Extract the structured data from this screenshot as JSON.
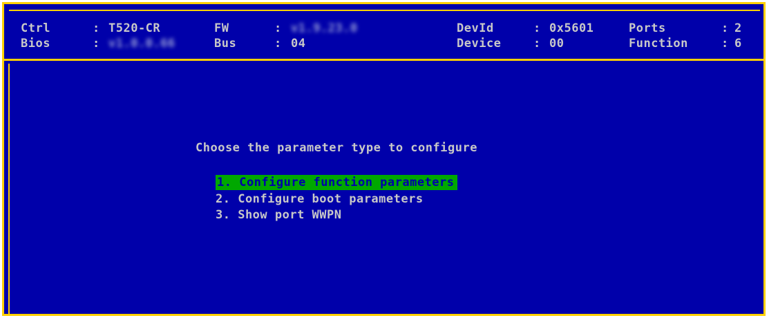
{
  "header": {
    "ctrl": {
      "label": "Ctrl",
      "sep": ":",
      "value": "T520-CR"
    },
    "bios": {
      "label": "Bios",
      "sep": ":",
      "value": "v1.0.0.66"
    },
    "fw": {
      "label": "FW",
      "sep": ":",
      "value": "v1.9.23.0"
    },
    "bus": {
      "label": "Bus",
      "sep": ":",
      "value": "04"
    },
    "devid": {
      "label": "DevId",
      "sep": ":",
      "value": "0x5601"
    },
    "device": {
      "label": "Device",
      "sep": ":",
      "value": "00"
    },
    "ports": {
      "label": "Ports",
      "sep": ":",
      "value": "2"
    },
    "function": {
      "label": "Function",
      "sep": ":",
      "value": "6"
    }
  },
  "menu": {
    "title": "Choose the parameter type to configure",
    "items": [
      {
        "label": "1. Configure function parameters",
        "selected": true
      },
      {
        "label": "2. Configure boot parameters",
        "selected": false
      },
      {
        "label": "3. Show port WWPN",
        "selected": false
      }
    ]
  },
  "colors": {
    "background": "#0000aa",
    "border": "#ffd000",
    "text": "#c8c8c8",
    "selection": "#00a800"
  }
}
